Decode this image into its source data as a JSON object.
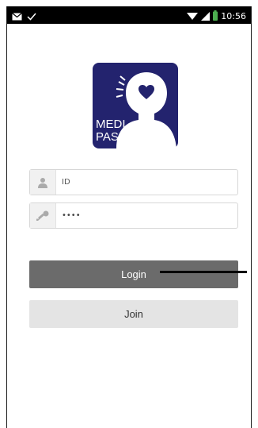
{
  "status_bar": {
    "time": "10:56",
    "icons": [
      "mail-icon",
      "check-icon",
      "wifi-icon",
      "signal-icon",
      "battery-icon"
    ]
  },
  "logo": {
    "line1": "MEDI",
    "line2": "PASS",
    "background_color": "#23236e"
  },
  "login_form": {
    "id_field": {
      "placeholder": "ID",
      "icon": "user-icon"
    },
    "password_field": {
      "value": "••••",
      "icon": "key-icon"
    },
    "login_label": "Login",
    "join_label": "Join"
  },
  "colors": {
    "login_button": "#6b6b6b",
    "join_button": "#e4e4e4",
    "battery": "#4caf50"
  }
}
